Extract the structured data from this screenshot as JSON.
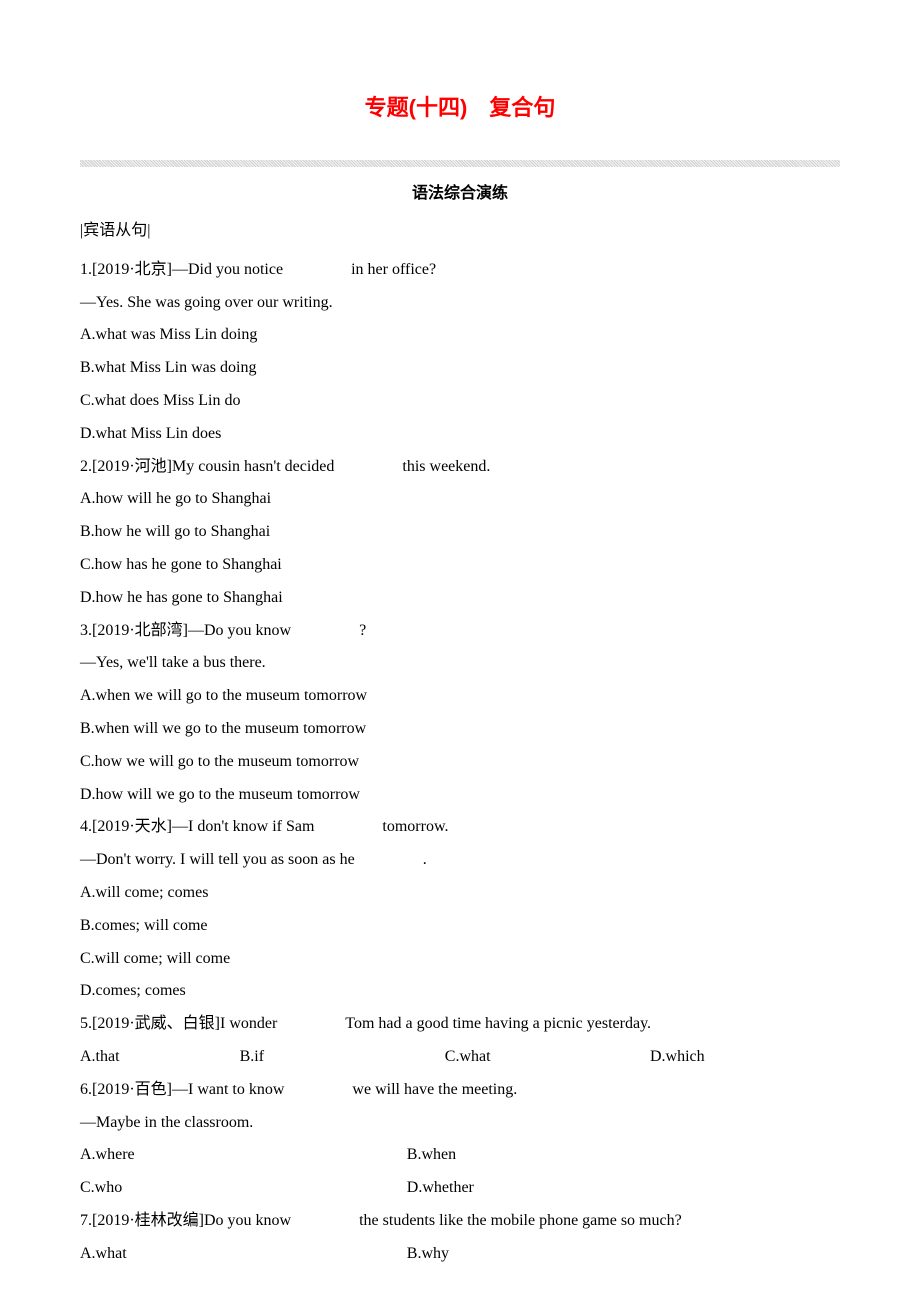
{
  "title": "专题(十四)　复合句",
  "subtitle": "语法综合演练",
  "section": "|宾语从句|",
  "blank": "　　　　",
  "q1": {
    "stem": "1.[2019·北京]—Did you notice 　　　　in her office?",
    "resp": "—Yes. She was going over our writing.",
    "a": "A.what was Miss Lin doing",
    "b": "B.what Miss Lin was doing",
    "c": "C.what does Miss Lin do",
    "d": "D.what Miss Lin does"
  },
  "q2": {
    "stem": "2.[2019·河池]My cousin hasn't decided 　　　　this weekend.",
    "a": "A.how will he go to Shanghai",
    "b": "B.how he will go to Shanghai",
    "c": "C.how has he gone to Shanghai",
    "d": "D.how he has gone to Shanghai"
  },
  "q3": {
    "stem": "3.[2019·北部湾]—Do you know 　　　　?",
    "resp": "—Yes, we'll take a bus there.",
    "a": "A.when we will go to the museum tomorrow",
    "b": "B.when will we go to the museum tomorrow",
    "c": "C.how we will go to the museum tomorrow",
    "d": "D.how will we go to the museum tomorrow"
  },
  "q4": {
    "stem": "4.[2019·天水]—I don't know if Sam 　　　　tomorrow.",
    "resp": "—Don't worry. I will tell you as soon as he 　　　　.",
    "a": "A.will come; comes",
    "b": "B.comes; will come",
    "c": "C.will come; will come",
    "d": "D.comes; comes"
  },
  "q5": {
    "stem": "5.[2019·武威、白银]I wonder 　　　　Tom had a good time having a picnic yesterday.",
    "a": "A.that",
    "b": "B.if",
    "c": "C.what",
    "d": "D.which"
  },
  "q6": {
    "stem": "6.[2019·百色]—I want to know 　　　　we will have the meeting.",
    "resp": "—Maybe in the classroom.",
    "a": "A.where",
    "b": "B.when",
    "c": "C.who",
    "d": "D.whether"
  },
  "q7": {
    "stem": "7.[2019·桂林改编]Do you know 　　　　the students like the mobile phone game so much?",
    "a": "A.what",
    "b": "B.why"
  }
}
